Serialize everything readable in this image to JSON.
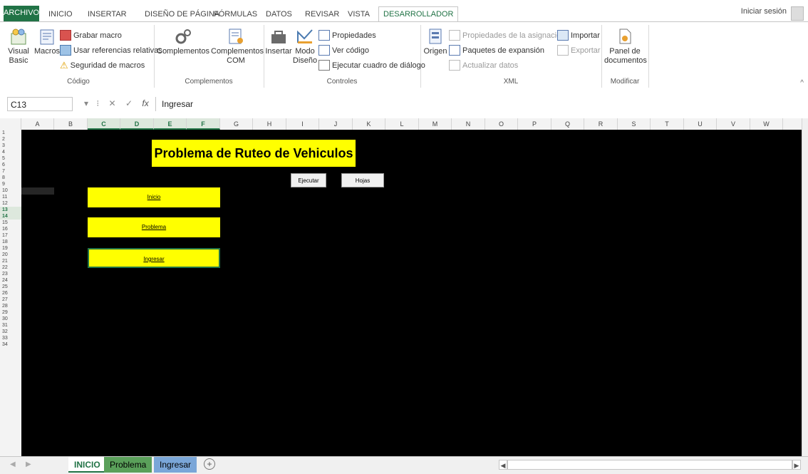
{
  "ribbon_tabs": [
    "ARCHIVO",
    "INICIO",
    "INSERTAR",
    "DISEÑO DE PÁGINA",
    "FÓRMULAS",
    "DATOS",
    "REVISAR",
    "VISTA",
    "DESARROLLADOR"
  ],
  "sign_in": "Iniciar sesión",
  "groups": {
    "codigo": {
      "label": "Código",
      "visual_basic": "Visual Basic",
      "macros": "Macros",
      "grabar": "Grabar macro",
      "referencias": "Usar referencias relativas",
      "seguridad": "Seguridad de macros"
    },
    "complementos": {
      "label": "Complementos",
      "complementos": "Complementos",
      "complementos_com": "Complementos COM"
    },
    "controles": {
      "label": "Controles",
      "insertar": "Insertar",
      "modo_diseno": "Modo Diseño",
      "propiedades": "Propiedades",
      "ver_codigo": "Ver código",
      "ejecutar_dialogo": "Ejecutar cuadro de diálogo"
    },
    "xml": {
      "label": "XML",
      "origen": "Origen",
      "propiedades_asig": "Propiedades de la asignación",
      "paquetes": "Paquetes de expansión",
      "actualizar": "Actualizar datos",
      "importar": "Importar",
      "exportar": "Exportar"
    },
    "modificar": {
      "label": "Modificar",
      "panel": "Panel de documentos"
    }
  },
  "formula_bar": {
    "name_box": "C13",
    "fx": "fx",
    "content": "Ingresar"
  },
  "columns": [
    "A",
    "B",
    "C",
    "D",
    "E",
    "F",
    "G",
    "H",
    "I",
    "J",
    "K",
    "L",
    "M",
    "N",
    "O",
    "P",
    "Q",
    "R",
    "S",
    "T",
    "U",
    "V",
    "W"
  ],
  "sheet": {
    "title": "Problema de Ruteo de Vehiculos",
    "btn_ejecutar": "Ejecutar",
    "btn_hojas": "Hojas",
    "link_inicio": "Inicio",
    "link_problema": "Problema",
    "link_ingresar": "Ingresar"
  },
  "sheet_tabs": [
    "INICIO",
    "Problema",
    "Ingresar"
  ],
  "colors": {
    "excel_green": "#217346",
    "yellow": "#ffff00",
    "sheet_bg": "#000000",
    "tab_problema": "#5aa05a",
    "tab_ingresar": "#7aa6d8"
  }
}
